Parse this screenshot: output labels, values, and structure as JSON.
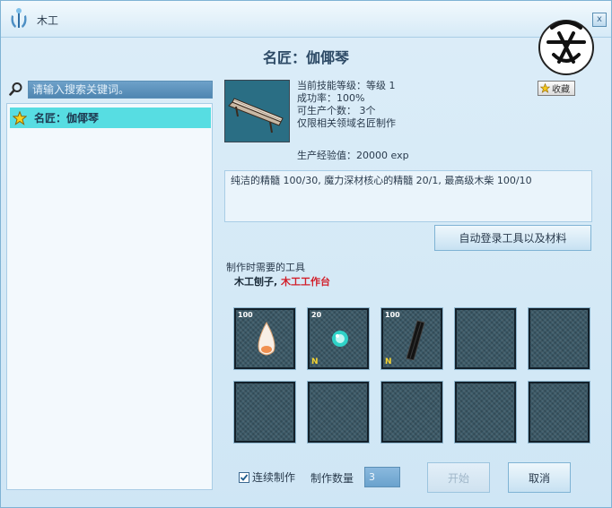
{
  "window": {
    "title": "木工",
    "close_label": "x"
  },
  "header": {
    "title": "名匠：伽倻琴",
    "favorite_label": "收藏"
  },
  "search": {
    "placeholder": "请输入搜索关键词。",
    "value": ""
  },
  "recipe_list": [
    {
      "label": "名匠：伽倻琴",
      "selected": true
    }
  ],
  "item_info": {
    "skill_level": "当前技能等级：等级 1",
    "success_rate": "成功率：100%",
    "producible_count": "可生产个数： 3个",
    "restriction": "仅限相关领域名匠制作",
    "exp": "生产经验值：20000 exp"
  },
  "materials_text": "纯洁的精髓 100/30, 魔力深材核心的精髓 20/1, 最高级木柴 100/10",
  "auto_button_label": "自动登录工具以及材料",
  "tools": {
    "label": "制作时需要的工具",
    "tool_a": "木工刨子,",
    "tool_b": "木工工作台"
  },
  "slots": [
    {
      "count": "100",
      "icon": "spirit-essence-icon",
      "badge": ""
    },
    {
      "count": "20",
      "icon": "magic-core-essence-icon",
      "badge": "N"
    },
    {
      "count": "100",
      "icon": "firewood-icon",
      "badge": "N"
    }
  ],
  "bottom": {
    "continuous_label": "连续制作",
    "continuous_checked": true,
    "quantity_label": "制作数量",
    "quantity_value": "3",
    "start_label": "开始",
    "cancel_label": "取消"
  },
  "colors": {
    "selected_item": "#57dde2",
    "tool_required": "#d21f2a",
    "panel": "#d3e8f6"
  }
}
